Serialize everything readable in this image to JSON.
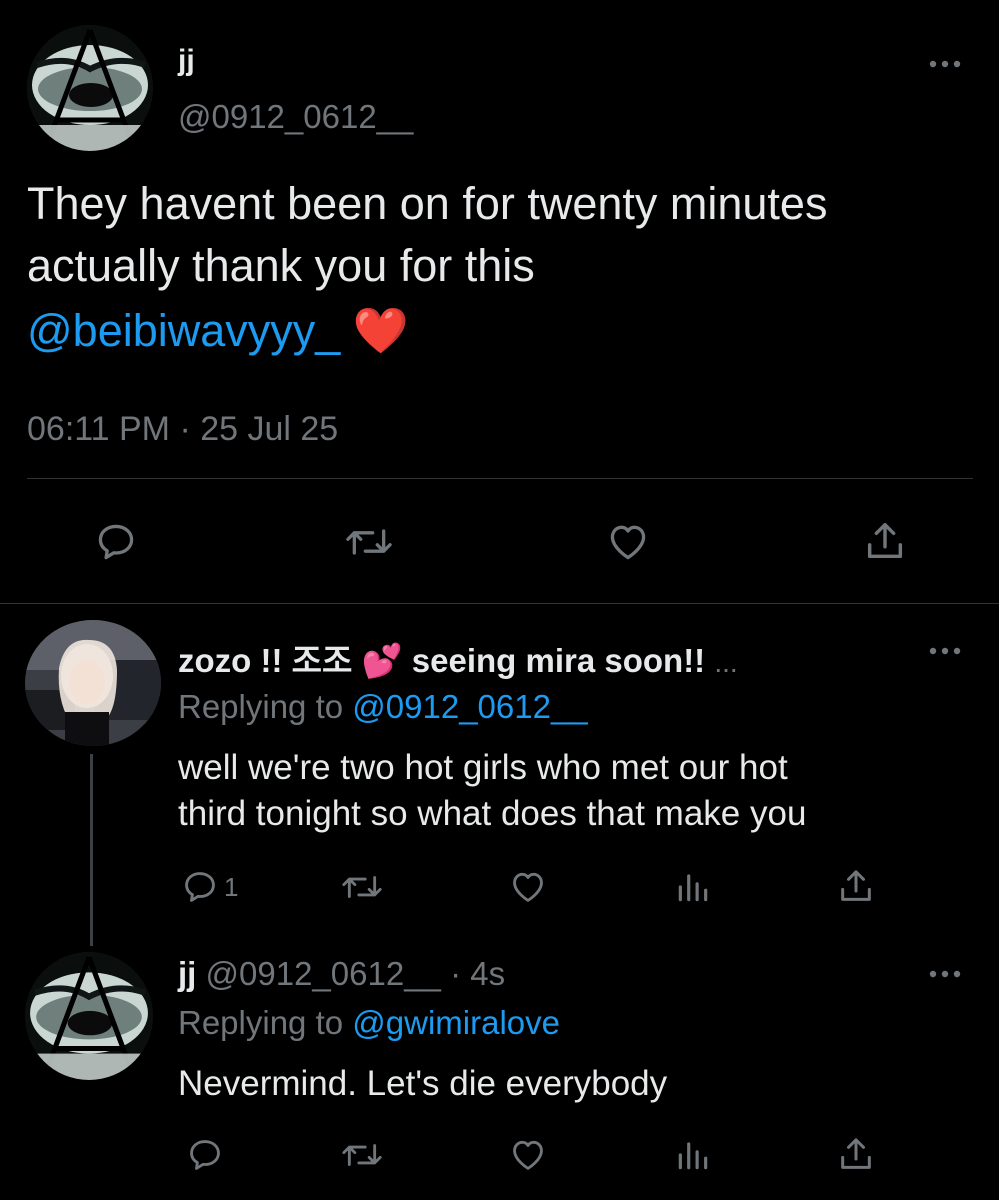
{
  "main_tweet": {
    "display_name": "jj",
    "handle": "@0912_0612__",
    "text_line1": "They havent been on for twenty minutes",
    "text_line2": "actually thank you for this",
    "mention": "@beibiwavyyy_",
    "emoji": "❤️",
    "timestamp": "06:11 PM · 25 Jul 25"
  },
  "reply1": {
    "display_name": "zozo !! 조조 💕 seeing mira soon!!",
    "ellipsis": "...",
    "replying_prefix": "Replying to",
    "replying_to": "@0912_0612__",
    "text_line1": "well we're two hot girls who met our hot",
    "text_line2": "third tonight so what does that make you",
    "reply_count": "1"
  },
  "reply2": {
    "display_name": "jj",
    "handle": "@0912_0612__",
    "time": "· 4s",
    "replying_prefix": "Replying to",
    "replying_to": "@gwimiralove",
    "text": "Nevermind. Let's die everybody"
  },
  "icons": {
    "reply": "speech-bubble-icon",
    "retweet": "retweet-icon",
    "like": "heart-icon",
    "share": "share-upload-icon",
    "views": "analytics-bars-icon",
    "more": "ellipsis-icon"
  },
  "colors": {
    "background": "#000000",
    "text": "#e7e9ea",
    "muted": "#71767b",
    "link": "#1d9bf0",
    "divider": "#2f3336"
  }
}
